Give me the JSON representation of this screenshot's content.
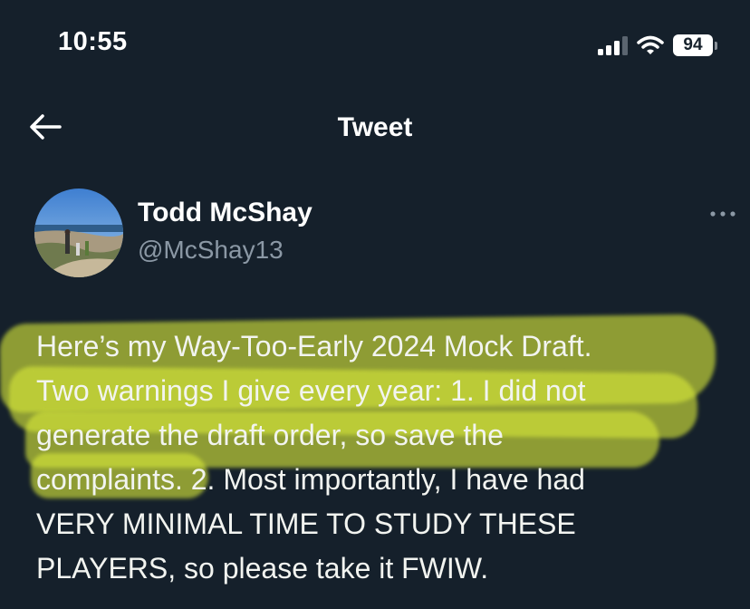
{
  "status_bar": {
    "time": "10:55",
    "battery": "94"
  },
  "header": {
    "title": "Tweet"
  },
  "author": {
    "display_name": "Todd McShay",
    "handle": "@McShay13"
  },
  "tweet": {
    "lines": [
      "Here’s my Way-Too-Early 2024 Mock Draft.",
      "Two warnings I give every year: 1. I did not",
      "generate the draft order, so save the",
      "complaints. 2. Most importantly, I have had",
      "VERY MINIMAL TIME TO STUDY THESE",
      "PLAYERS, so please take it FWIW."
    ]
  },
  "colors": {
    "background": "#15202b",
    "secondary_text": "#8b98a5",
    "highlighter": "#d8e93a"
  },
  "icons": [
    "cellular-signal-icon",
    "wifi-icon",
    "battery-icon",
    "back-arrow-icon",
    "more-options-icon"
  ]
}
